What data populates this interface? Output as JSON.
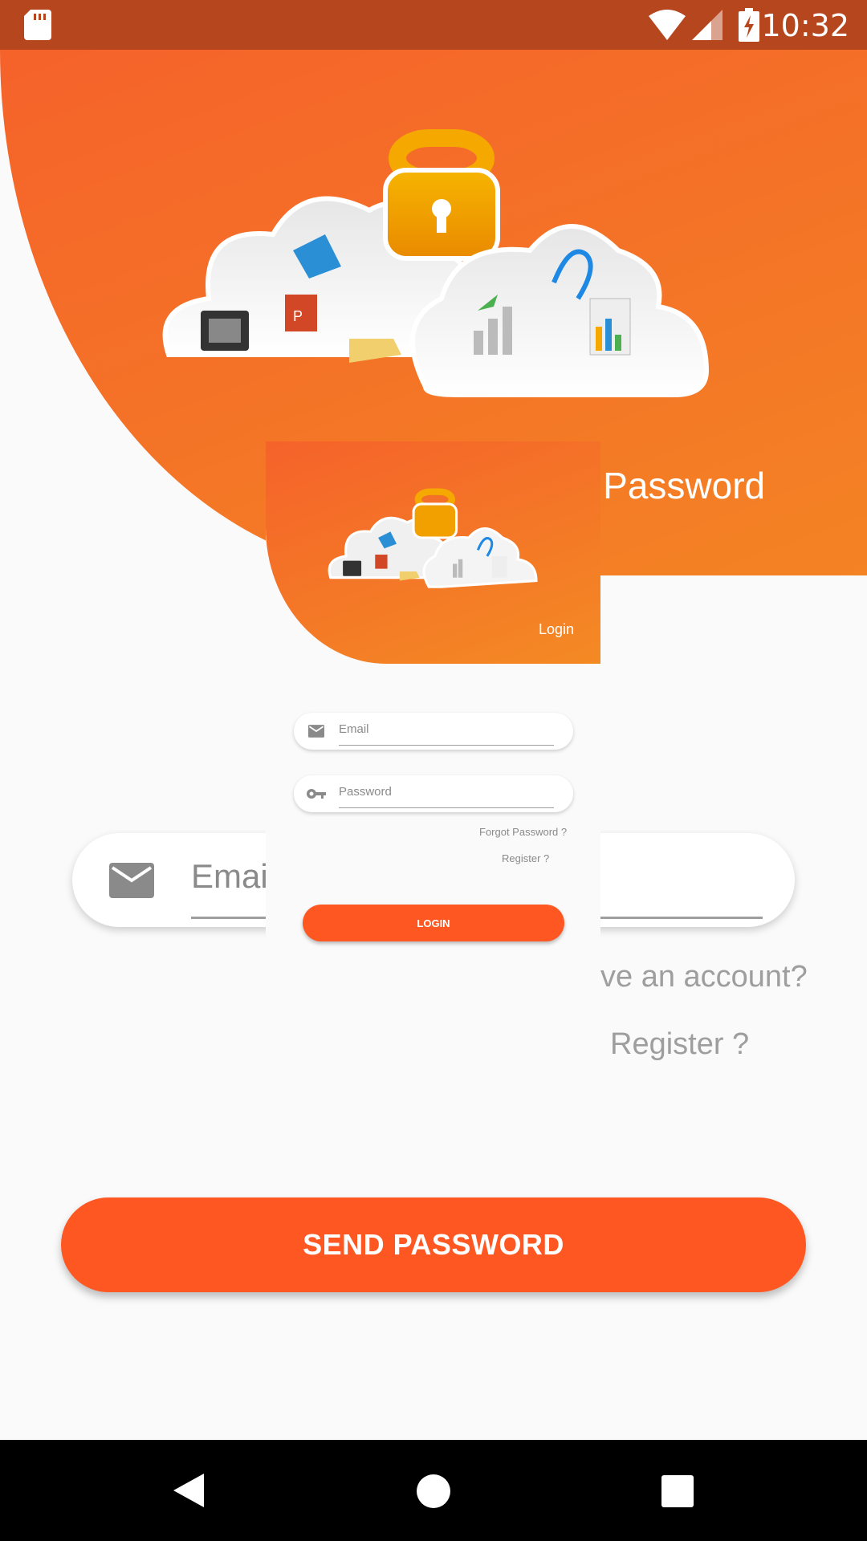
{
  "status_bar": {
    "time": "10:32"
  },
  "header": {
    "title": "et Password"
  },
  "email_field": {
    "placeholder": "Emai"
  },
  "have_account_text": "ve an account?",
  "register_link": "Register ?",
  "send_button": "SEND PASSWORD",
  "login_card": {
    "header_label": "Login",
    "email_placeholder": "Email",
    "password_placeholder": "Password",
    "forgot_link": "Forgot Password ?",
    "register_link": "Register ?",
    "login_button": "LOGIN"
  },
  "colors": {
    "accent": "#ff5722",
    "header_start": "#f5622a",
    "header_end": "#f48a24",
    "status_bar": "#b5461e"
  }
}
